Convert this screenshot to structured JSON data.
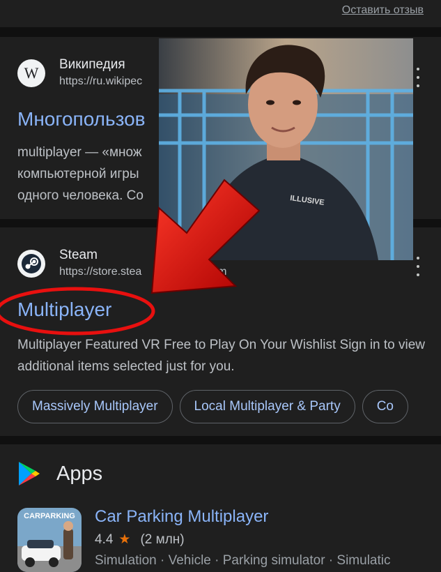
{
  "feedback_link": "Оставить отзыв",
  "result1": {
    "source_name": "Википедия",
    "source_url": "https://ru.wikipec",
    "favicon_letter": "W",
    "title": "Многопользов",
    "snippet_lines": [
      "multiplayer — «множ",
      "компьютерной игры",
      "одного человека. Co"
    ]
  },
  "result2": {
    "source_name": "Steam",
    "source_url_start": "https://store.stea",
    "source_url_end": "com",
    "title": "Multiplayer",
    "snippet": "Multiplayer Featured VR Free to Play On Your Wishlist Sign in to view additional items selected just for you.",
    "chips": [
      "Massively Multiplayer",
      "Local Multiplayer & Party",
      "Co"
    ]
  },
  "overlay_photo": {
    "shirt_text": "ILLUSIVE"
  },
  "annotations": {
    "arrow_color": "#e8100f",
    "circle_color": "#e8100f"
  },
  "apps": {
    "heading": "Apps",
    "app_name": "Car Parking Multiplayer",
    "rating": "4.4",
    "reviews": "(2 млн)",
    "categories": "Simulation · Vehicle · Parking simulator · Simulatic",
    "icon_text": "CARPARKING"
  },
  "colors": {
    "link_blue": "#8ab4f8",
    "background": "#1f1f1f",
    "separator": "#101010"
  }
}
